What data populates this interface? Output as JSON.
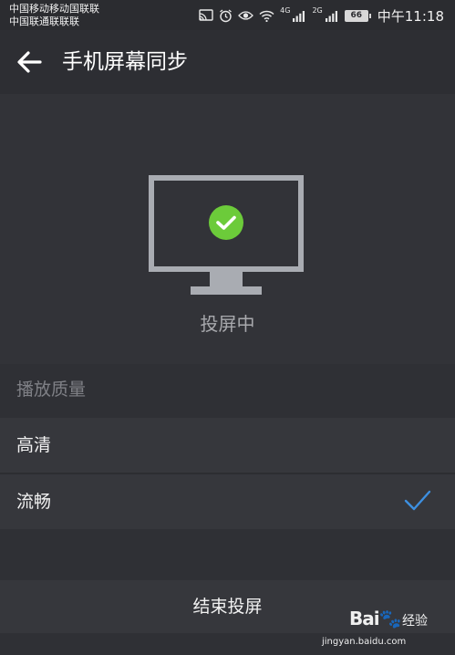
{
  "status_bar": {
    "carrier_1": "中国移动移动国联联",
    "carrier_2": "中国联通联联联",
    "network_1": "4G",
    "network_2": "2G",
    "battery": "66",
    "time": "中午11:18"
  },
  "header": {
    "title": "手机屏幕同步"
  },
  "hero": {
    "status": "投屏中"
  },
  "quality": {
    "label": "播放质量",
    "options": [
      {
        "label": "高清",
        "selected": false
      },
      {
        "label": "流畅",
        "selected": true
      }
    ]
  },
  "actions": {
    "end_label": "结束投屏"
  },
  "watermark": {
    "logo": "Bai",
    "brand": "经验",
    "url": "jingyan.baidu.com"
  },
  "colors": {
    "check_green": "#6ccb3a",
    "check_blue": "#3d8fe0",
    "monitor_gray": "#a9acb2"
  }
}
